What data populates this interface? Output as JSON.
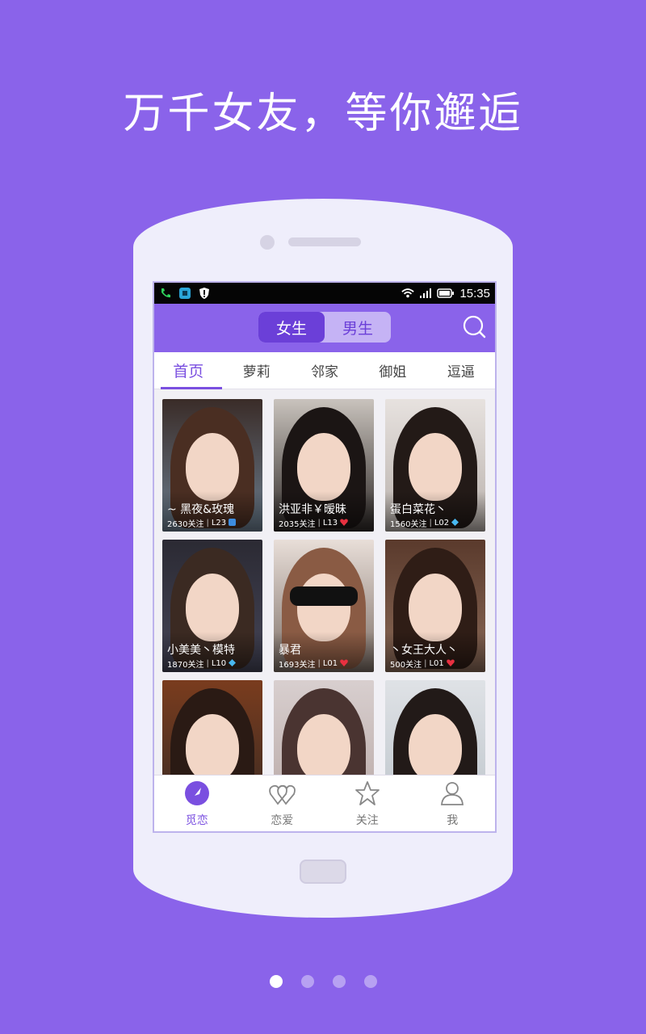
{
  "headline": "万千女友，等你邂逅",
  "colors": {
    "background": "#8a63ea",
    "accent": "#7a4fe0",
    "segment_active": "#6b3fd8"
  },
  "status_bar": {
    "time": "15:35",
    "icons": [
      "call-icon",
      "app-icon",
      "shield-icon",
      "wifi-icon",
      "signal-icon",
      "battery-icon"
    ]
  },
  "segment": {
    "options": [
      "女生",
      "男生"
    ],
    "selected": "女生"
  },
  "tabs": [
    "首页",
    "萝莉",
    "邻家",
    "御姐",
    "逗逼"
  ],
  "active_tab": "首页",
  "cards": [
    {
      "name": "~ 黑夜&玫瑰",
      "followers": "2630关注",
      "level": "L23",
      "badge": "vip-icon"
    },
    {
      "name": "洪亚非￥暧昧",
      "followers": "2035关注",
      "level": "L13",
      "badge": "heart-icon"
    },
    {
      "name": "蛋白菜花丶",
      "followers": "1560关注",
      "level": "L02",
      "badge": "diamond-icon"
    },
    {
      "name": "小美美丶模特",
      "followers": "1870关注",
      "level": "L10",
      "badge": "diamond-icon"
    },
    {
      "name": "暴君",
      "followers": "1693关注",
      "level": "L01",
      "badge": "heart-icon"
    },
    {
      "name": "丶女王大人丶",
      "followers": "500关注",
      "level": "L01",
      "badge": "heart-icon"
    },
    {
      "name": "",
      "followers": "",
      "level": "",
      "badge": ""
    },
    {
      "name": "",
      "followers": "",
      "level": "",
      "badge": ""
    },
    {
      "name": "",
      "followers": "",
      "level": "",
      "badge": ""
    }
  ],
  "bottom_nav": [
    {
      "label": "觅恋",
      "icon": "compass-icon",
      "active": true
    },
    {
      "label": "恋爱",
      "icon": "hearts-icon",
      "active": false
    },
    {
      "label": "关注",
      "icon": "star-icon",
      "active": false
    },
    {
      "label": "我",
      "icon": "person-icon",
      "active": false
    }
  ],
  "pager": {
    "total": 4,
    "current": 1
  }
}
